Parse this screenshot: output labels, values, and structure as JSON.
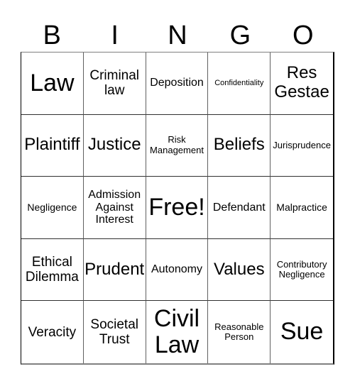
{
  "header": {
    "letters": [
      "B",
      "I",
      "N",
      "G",
      "O"
    ]
  },
  "board": {
    "rows": [
      [
        "Law",
        "Criminal law",
        "Deposition",
        "Confidentiality",
        "Res Gestae"
      ],
      [
        "Plaintiff",
        "Justice",
        "Risk Management",
        "Beliefs",
        "Jurisprudence"
      ],
      [
        "Negligence",
        "Admission Against Interest",
        "Free!",
        "Defendant",
        "Malpractice"
      ],
      [
        "Ethical Dilemma",
        "Prudent",
        "Autonomy",
        "Values",
        "Contributory Negligence"
      ],
      [
        "Veracity",
        "Societal Trust",
        "Civil Law",
        "Reasonable Person",
        "Sue"
      ]
    ],
    "free_space_label": "Free!"
  }
}
